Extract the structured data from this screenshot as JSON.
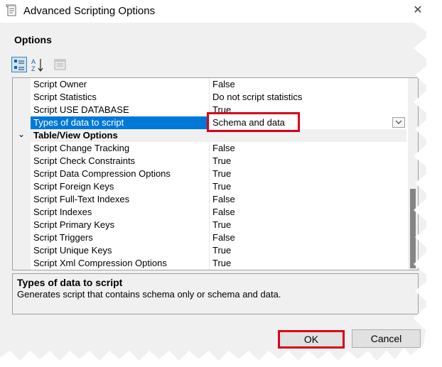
{
  "window": {
    "title": "Advanced Scripting Options",
    "close_glyph": "✕"
  },
  "section_label": "Options",
  "toolbar": {
    "categorized_icon": "categorized-icon",
    "alphabetical_icon": "alphabetical-sort-icon",
    "property_pages_icon": "property-pages-icon",
    "az_top": "A",
    "az_bottom": "Z"
  },
  "grid": {
    "rows_top": [
      {
        "name": "Script Owner",
        "value": "False"
      },
      {
        "name": "Script Statistics",
        "value": "Do not script statistics"
      },
      {
        "name": "Script USE DATABASE",
        "value": "True"
      },
      {
        "name": "Types of data to script",
        "value": "Schema and data"
      }
    ],
    "category": {
      "label": "Table/View Options",
      "chevron": "⌄"
    },
    "rows_table": [
      {
        "name": "Script Change Tracking",
        "value": "False"
      },
      {
        "name": "Script Check Constraints",
        "value": "True"
      },
      {
        "name": "Script Data Compression Options",
        "value": "True"
      },
      {
        "name": "Script Foreign Keys",
        "value": "True"
      },
      {
        "name": "Script Full-Text Indexes",
        "value": "False"
      },
      {
        "name": "Script Indexes",
        "value": "False"
      },
      {
        "name": "Script Primary Keys",
        "value": "True"
      },
      {
        "name": "Script Triggers",
        "value": "False"
      },
      {
        "name": "Script Unique Keys",
        "value": "True"
      },
      {
        "name": "Script Xml Compression Options",
        "value": "True"
      }
    ]
  },
  "description": {
    "title": "Types of data to script",
    "text": "Generates script that contains schema only or schema and data."
  },
  "buttons": {
    "ok": "OK",
    "cancel": "Cancel"
  },
  "colors": {
    "selection": "#0078d7",
    "highlight": "#d9001b"
  }
}
